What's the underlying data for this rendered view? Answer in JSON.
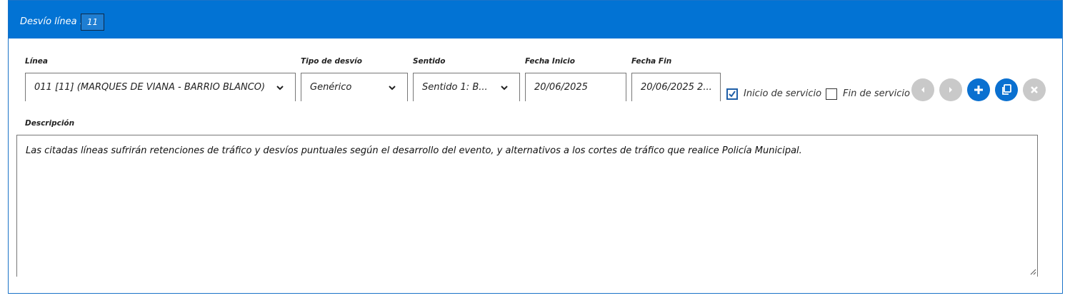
{
  "header": {
    "title": "Desvío línea :",
    "number": "11"
  },
  "fields": {
    "linea": {
      "label": "Línea",
      "value": "011 [11] (MARQUES DE VIANA - BARRIO BLANCO)"
    },
    "tipo": {
      "label": "Tipo de desvío",
      "value": "Genérico"
    },
    "sentido": {
      "label": "Sentido",
      "value": "Sentido 1: B..."
    },
    "fecha_inicio": {
      "label": "Fecha Inicio",
      "value": "20/06/2025"
    },
    "fecha_fin": {
      "label": "Fecha Fin",
      "value": "20/06/2025 2..."
    }
  },
  "checkboxes": {
    "inicio": {
      "label": "Inicio de servicio",
      "checked": true
    },
    "fin": {
      "label": "Fin de servicio",
      "checked": false
    }
  },
  "buttons": {
    "prev": "chevron-left-icon",
    "next": "chevron-right-icon",
    "add": "plus-icon",
    "copy": "copy-icon",
    "delete": "close-icon"
  },
  "descripcion": {
    "label": "Descripción",
    "value": "Las citadas líneas sufrirán retenciones de tráfico y desvíos puntuales según el desarrollo del evento, y alternativos a los cortes de tráfico que realice Policía Municipal."
  },
  "colors": {
    "header": "#0273d4",
    "accent": "#0a70d0",
    "disabled": "#c9c9c9"
  }
}
